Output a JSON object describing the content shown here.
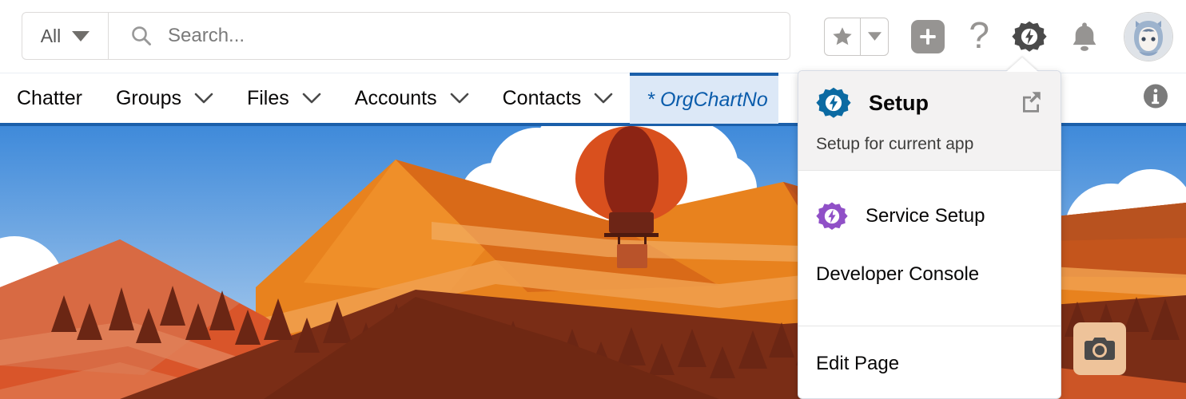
{
  "colors": {
    "brand_blue": "#1b5faa",
    "active_tab_bg": "#dce8f7",
    "active_tab_text": "#0b5cab",
    "setup_gear_blue": "#0b6aa2",
    "service_setup_purple": "#9050c7",
    "icon_gray": "#969492",
    "menu_header_bg": "#f3f2f2",
    "camera_btn_bg": "#eec39a"
  },
  "search": {
    "scope_label": "All",
    "scope_caret_icon": "caret-down-icon",
    "search_icon": "search-icon",
    "placeholder": "Search...",
    "value": ""
  },
  "header_icons": {
    "favorites_star_icon": "star-icon",
    "favorites_caret_icon": "caret-down-icon",
    "add_icon": "plus-icon",
    "help_label": "?",
    "help_icon": "question-mark-icon",
    "setup_icon": "gear-lightning-icon",
    "notifications_icon": "bell-icon",
    "avatar_icon": "user-avatar-astro"
  },
  "nav": {
    "items": [
      {
        "label": "Chatter",
        "has_dropdown": false,
        "active": false
      },
      {
        "label": "Groups",
        "has_dropdown": true,
        "active": false
      },
      {
        "label": "Files",
        "has_dropdown": true,
        "active": false
      },
      {
        "label": "Accounts",
        "has_dropdown": true,
        "active": false
      },
      {
        "label": "Contacts",
        "has_dropdown": true,
        "active": false
      },
      {
        "label": "* OrgChartNo",
        "has_dropdown": false,
        "active": true
      }
    ],
    "info_icon": "info-icon"
  },
  "setup_menu": {
    "header": {
      "icon": "gear-lightning-icon",
      "title": "Setup",
      "external_link_icon": "external-link-icon",
      "subtitle": "Setup for current app"
    },
    "items": [
      {
        "label": "Service Setup",
        "icon": "gear-lightning-icon"
      },
      {
        "label": "Developer Console",
        "icon": null
      },
      {
        "label": "Edit Page",
        "icon": null
      }
    ]
  },
  "canvas": {
    "camera_button_icon": "camera-icon",
    "illustration": "canyon-landscape-with-hot-air-balloon"
  }
}
